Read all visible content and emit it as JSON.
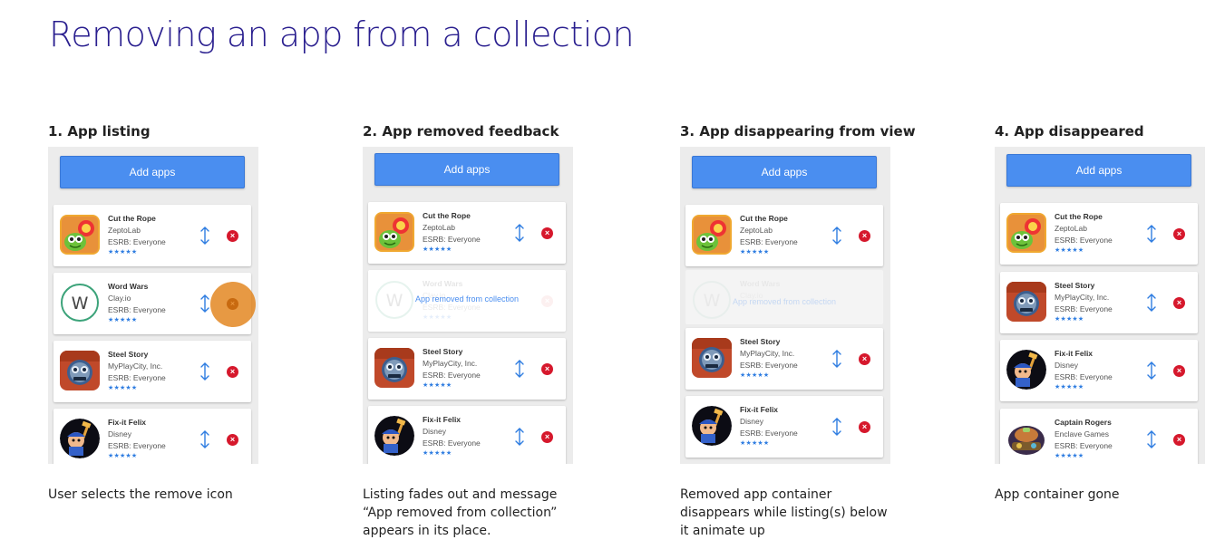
{
  "title": "Removing an app from a collection",
  "apps": {
    "cut_the_rope": {
      "name": "Cut the Rope",
      "developer": "ZeptoLab",
      "rating": "ESRB: Everyone",
      "stars": "★★★★★"
    },
    "word_wars": {
      "name": "Word Wars",
      "developer": "Clay.io",
      "rating": "ESRB: Everyone",
      "stars": "★★★★★",
      "icon_letter": "W"
    },
    "steel_story": {
      "name": "Steel Story",
      "developer": "MyPlayCity, Inc.",
      "rating": "ESRB: Everyone",
      "stars": "★★★★★"
    },
    "fix_it_felix": {
      "name": "Fix-it Felix",
      "developer": "Disney",
      "rating": "ESRB: Everyone",
      "stars": "★★★★★"
    },
    "captain_rogers": {
      "name": "Captain Rogers",
      "developer": "Enclave Games",
      "rating": "ESRB: Everyone",
      "stars": "★★★★★"
    }
  },
  "icons": {
    "reorder": "up-down-arrow-icon",
    "remove": "close-circle-icon",
    "remove_glyph": "×"
  },
  "steps": [
    {
      "heading": "1. App listing",
      "add_apps_label": "Add apps",
      "caption": "User selects the remove icon"
    },
    {
      "heading": "2. App removed feedback",
      "add_apps_label": "Add apps",
      "feedback": "App removed from collection",
      "caption": "Listing fades out and message “App removed from collection” appears in its place."
    },
    {
      "heading": "3. App disappearing from view",
      "add_apps_label": "Add apps",
      "feedback": "App removed from collection",
      "caption": "Removed app container disappears while listing(s) below it animate up"
    },
    {
      "heading": "4. App disappeared",
      "add_apps_label": "Add apps",
      "caption": "App container gone"
    }
  ],
  "colors": {
    "title": "#2a1f8f",
    "accent_blue": "#4a8ef0",
    "remove_red": "#d6182c",
    "tap_orange": "#e18014",
    "phone_bg": "#ececec"
  }
}
